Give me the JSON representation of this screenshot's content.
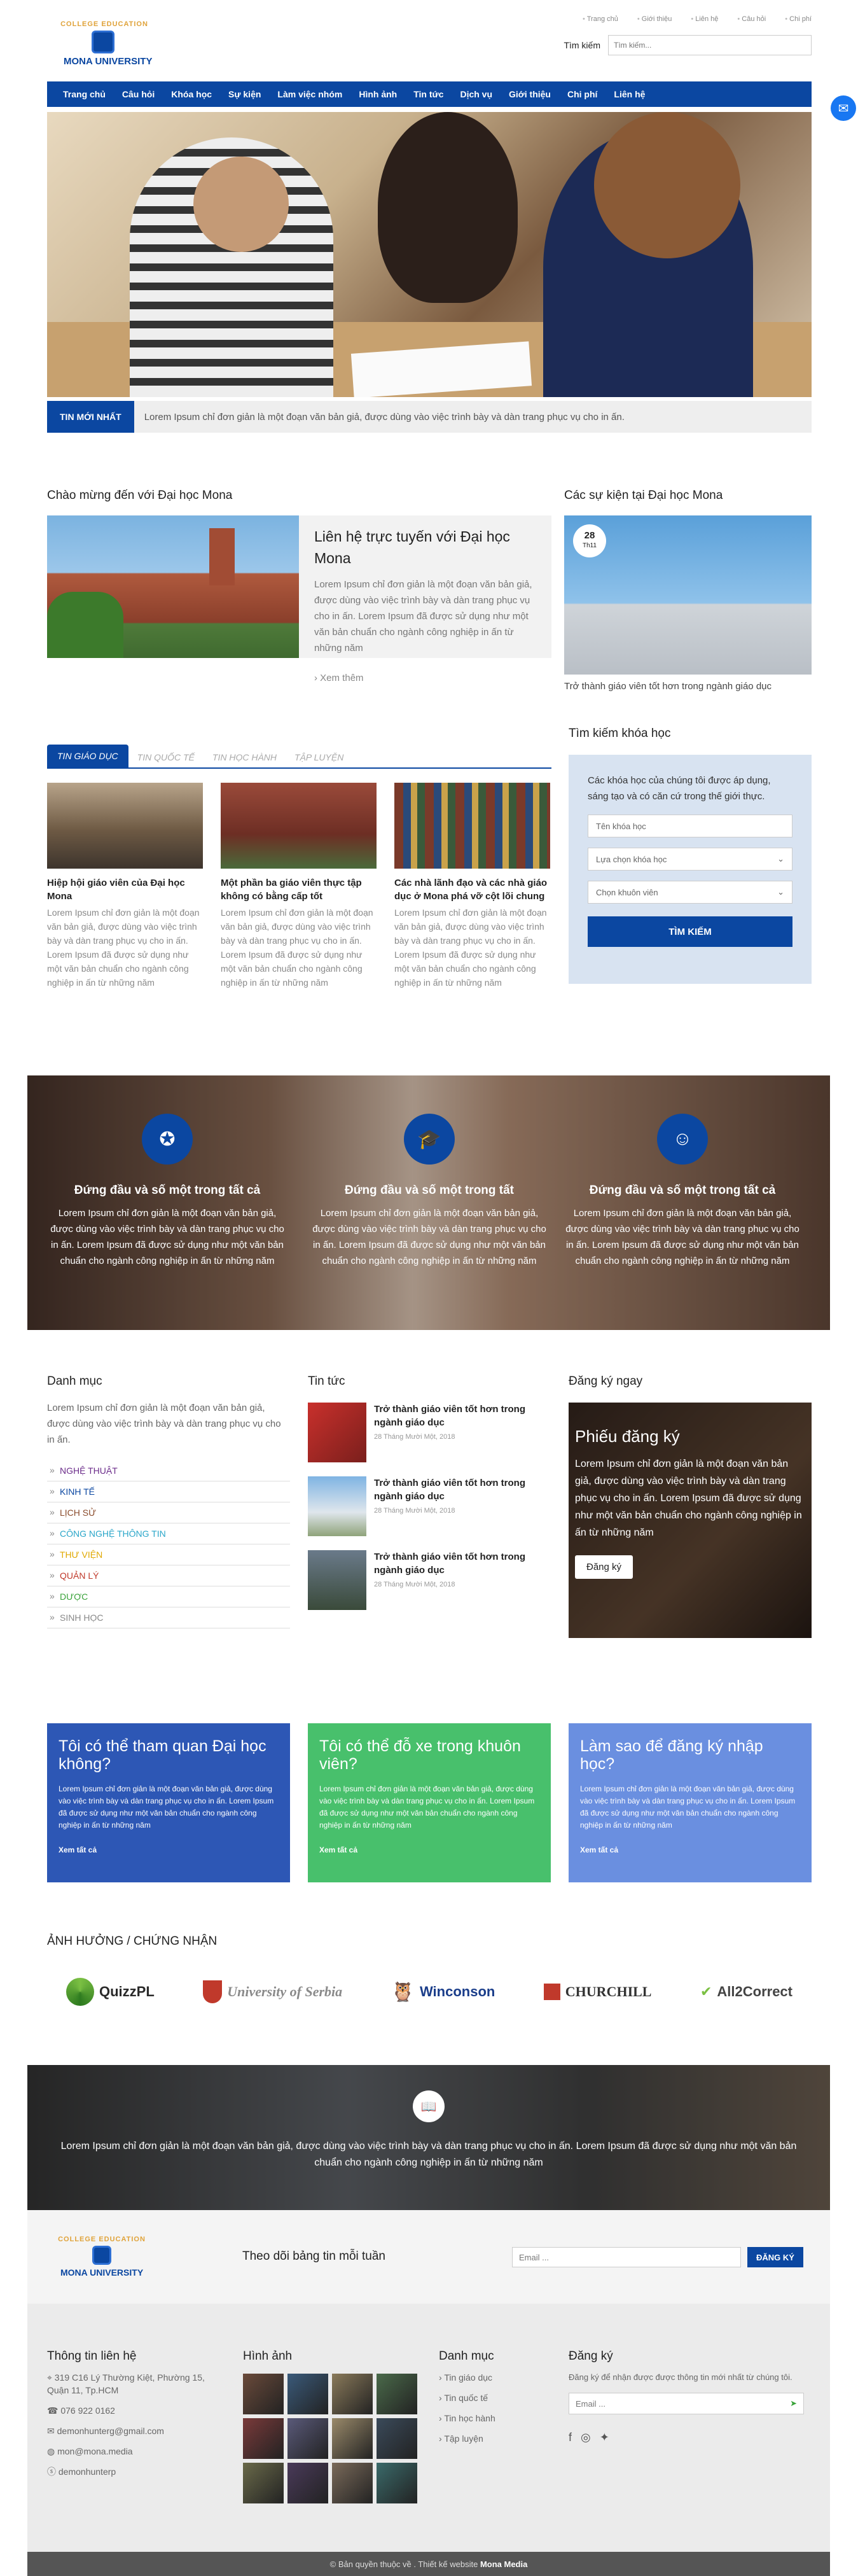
{
  "header": {
    "logo_top": "COLLEGE EDUCATION",
    "logo_name": "MONA UNIVERSITY",
    "toplinks": [
      "Trang chủ",
      "Giới thiệu",
      "Liên hệ",
      "Câu hỏi",
      "Chi phí"
    ],
    "search_label": "Tìm kiếm",
    "search_placeholder": "Tìm kiếm..."
  },
  "nav": [
    "Trang chủ",
    "Câu hỏi",
    "Khóa học",
    "Sự kiện",
    "Làm việc nhóm",
    "Hình ảnh",
    "Tin tức",
    "Dịch vụ",
    "Giới thiệu",
    "Chi phí",
    "Liên hệ"
  ],
  "ticker": {
    "label": "TIN MỚI NHẤT",
    "text": "Lorem Ipsum chỉ đơn giản là một đoạn văn bản giả, được dùng vào việc trình bày và dàn trang phục vụ cho in ấn."
  },
  "welcome": {
    "heading": "Chào mừng đến với Đại học Mona",
    "title": "Liên hệ trực tuyến với Đại học Mona",
    "desc": "Lorem Ipsum chỉ đơn giản là một đoạn văn bản giả, được dùng vào việc trình bày và dàn trang phục vụ cho in ấn. Lorem Ipsum đã được sử dụng như một văn bản chuẩn cho ngành công nghiệp in ấn từ những năm",
    "more": "Xem thêm"
  },
  "events": {
    "heading": "Các sự kiện tại Đại học Mona",
    "day": "28",
    "month": "Th11",
    "caption": "Trở thành giáo viên tốt hơn trong ngành giáo dục"
  },
  "tabs": [
    "TIN GIÁO DỤC",
    "TIN QUỐC TẾ",
    "TIN HỌC HÀNH",
    "TẬP LUYỆN"
  ],
  "news": [
    {
      "title": "Hiệp hội giáo viên của Đại học Mona",
      "desc": "Lorem Ipsum chỉ đơn giản là một đoạn văn bản giả, được dùng vào việc trình bày và dàn trang phục vụ cho in ấn. Lorem Ipsum đã được sử dụng như một văn bản chuẩn cho ngành công nghiệp in ấn từ những năm"
    },
    {
      "title": "Một phần ba giáo viên thực tập không có bằng cấp tốt",
      "desc": "Lorem Ipsum chỉ đơn giản là một đoạn văn bản giả, được dùng vào việc trình bày và dàn trang phục vụ cho in ấn. Lorem Ipsum đã được sử dụng như một văn bản chuẩn cho ngành công nghiệp in ấn từ những năm"
    },
    {
      "title": "Các nhà lãnh đạo và các nhà giáo dục ở Mona phá vỡ cột lõi chung",
      "desc": "Lorem Ipsum chỉ đơn giản là một đoạn văn bản giả, được dùng vào việc trình bày và dàn trang phục vụ cho in ấn. Lorem Ipsum đã được sử dụng như một văn bản chuẩn cho ngành công nghiệp in ấn từ những năm"
    }
  ],
  "course_search": {
    "heading": "Tìm kiếm khóa học",
    "intro": "Các khóa học của chúng tôi được áp dụng, sáng tạo và có căn cứ trong thế giới thực.",
    "name_placeholder": "Tên khóa học",
    "course_select": "Lựa chọn khóa học",
    "campus_select": "Chọn khuôn viên",
    "button": "TÌM KIẾM"
  },
  "features": [
    {
      "icon": "award-icon",
      "title": "Đứng đầu và số một trong tất cả",
      "desc": "Lorem Ipsum chỉ đơn giản là một đoạn văn bản giả, được dùng vào việc trình bày và dàn trang phục vụ cho in ấn. Lorem Ipsum đã được sử dụng như một văn bản chuẩn cho ngành công nghiệp in ấn từ những năm"
    },
    {
      "icon": "graduation-cap-icon",
      "title": "Đứng đầu và số một trong tất",
      "desc": "Lorem Ipsum chỉ đơn giản là một đoạn văn bản giả, được dùng vào việc trình bày và dàn trang phục vụ cho in ấn. Lorem Ipsum đã được sử dụng như một văn bản chuẩn cho ngành công nghiệp in ấn từ những năm"
    },
    {
      "icon": "theater-masks-icon",
      "title": "Đứng đầu và số một trong tất cả",
      "desc": "Lorem Ipsum chỉ đơn giản là một đoạn văn bản giả, được dùng vào việc trình bày và dàn trang phục vụ cho in ấn. Lorem Ipsum đã được sử dụng như một văn bản chuẩn cho ngành công nghiệp in ấn từ những năm"
    }
  ],
  "categories": {
    "heading": "Danh mục",
    "intro": "Lorem Ipsum chỉ đơn giản là một đoạn văn bản giả, được dùng vào việc trình bày và dàn trang phục vụ cho in ấn.",
    "items": [
      {
        "label": "NGHỆ THUẬT",
        "color": "#6b2c8a"
      },
      {
        "label": "KINH TẾ",
        "color": "#0b47a1"
      },
      {
        "label": "LỊCH SỬ",
        "color": "#8a4b2b"
      },
      {
        "label": "CÔNG NGHỆ THÔNG TIN",
        "color": "#2aa6c9"
      },
      {
        "label": "THƯ VIỆN",
        "color": "#e0a800"
      },
      {
        "label": "QUẢN LÝ",
        "color": "#c0392b"
      },
      {
        "label": "DƯỢC",
        "color": "#3aa33a"
      },
      {
        "label": "SINH HỌC",
        "color": "#888888"
      }
    ]
  },
  "latest": {
    "heading": "Tin tức",
    "items": [
      {
        "title": "Trở thành giáo viên tốt hơn trong ngành giáo dục",
        "date": "28 Tháng Mười Một, 2018"
      },
      {
        "title": "Trở thành giáo viên tốt hơn trong ngành giáo dục",
        "date": "28 Tháng Mười Một, 2018"
      },
      {
        "title": "Trở thành giáo viên tốt hơn trong ngành giáo dục",
        "date": "28 Tháng Mười Một, 2018"
      }
    ]
  },
  "register": {
    "heading": "Đăng ký ngay",
    "title": "Phiếu đăng ký",
    "desc": "Lorem Ipsum chỉ đơn giản là một đoạn văn bản giả, được dùng vào việc trình bày và dàn trang phục vụ cho in ấn. Lorem Ipsum đã được sử dụng như một văn bản chuẩn cho ngành công nghiệp in ấn từ những năm",
    "button": "Đăng ký"
  },
  "questions": [
    {
      "title": "Tôi có thể tham quan Đại học không?",
      "desc": "Lorem Ipsum chỉ đơn giản là một đoạn văn bản giả, được dùng vào việc trình bày và dàn trang phục vụ cho in ấn. Lorem Ipsum đã được sử dụng như một văn bản chuẩn cho ngành công nghiệp in ấn từ những năm",
      "more": "Xem tất cả",
      "color": "#2d57b5"
    },
    {
      "title": "Tôi có thể đỗ xe trong khuôn viên?",
      "desc": "Lorem Ipsum chỉ đơn giản là một đoạn văn bản giả, được dùng vào việc trình bày và dàn trang phục vụ cho in ấn. Lorem Ipsum đã được sử dụng như một văn bản chuẩn cho ngành công nghiệp in ấn từ những năm",
      "more": "Xem tất cả",
      "color": "#48c06c"
    },
    {
      "title": "Làm sao để đăng ký nhập học?",
      "desc": "Lorem Ipsum chỉ đơn giản là một đoạn văn bản giả, được dùng vào việc trình bày và dàn trang phục vụ cho in ấn. Lorem Ipsum đã được sử dụng như một văn bản chuẩn cho ngành công nghiệp in ấn từ những năm",
      "more": "Xem tất cả",
      "color": "#6a8fe0"
    }
  ],
  "partners": {
    "heading": "ẢNH HƯỞNG / CHỨNG NHẬN",
    "logos": [
      "QuizzPL",
      "University of Serbia",
      "Winconson",
      "CHURCHILL",
      "All2Correct"
    ]
  },
  "quote": "Lorem Ipsum chỉ đơn giản là một đoạn văn bản giả, được dùng vào việc trình bày và dàn trang phục vụ cho in ấn. Lorem Ipsum đã được sử dụng như một văn bản chuẩn cho ngành công nghiệp in ấn từ những năm",
  "newsletter": {
    "title": "Theo dõi bảng tin mỗi tuần",
    "placeholder": "Email ...",
    "button": "ĐĂNG KÝ"
  },
  "footer": {
    "contact": {
      "heading": "Thông tin liên hệ",
      "address": "319 C16 Lý Thường Kiệt, Phường 15, Quận 11, Tp.HCM",
      "phone": "076 922 0162",
      "email": "demonhunterg@gmail.com",
      "site": "mon@mona.media",
      "skype": "demonhunterp"
    },
    "gallery": {
      "heading": "Hình ảnh"
    },
    "menu": {
      "heading": "Danh mục",
      "items": [
        "Tin giáo dục",
        "Tin quốc tế",
        "Tin học hành",
        "Tập luyện"
      ]
    },
    "subscribe": {
      "heading": "Đăng ký",
      "desc": "Đăng ký để nhận được được thông tin mới nhất từ chúng tôi.",
      "placeholder": "Email ..."
    }
  },
  "copyright": "© Bản quyền thuộc về . Thiết kế website",
  "copyright_brand": "Mona Media"
}
